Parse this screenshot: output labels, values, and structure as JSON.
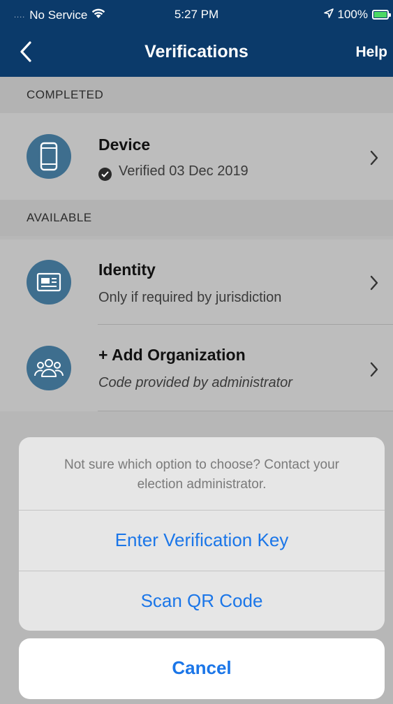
{
  "status_bar": {
    "carrier_dots": "....",
    "carrier": "No Service",
    "time": "5:27 PM",
    "battery": "100%",
    "icons": [
      "wifi-icon",
      "location-arrow-icon",
      "battery-charging-icon"
    ]
  },
  "nav": {
    "title": "Verifications",
    "help": "Help",
    "back_icon": "chevron-left-icon"
  },
  "completed": {
    "header": "COMPLETED",
    "items": [
      {
        "title": "Device",
        "subtitle": "Verified 03 Dec 2019",
        "icon": "phone-icon",
        "status_icon": "check-circle-icon"
      }
    ]
  },
  "available": {
    "header": "AVAILABLE",
    "items": [
      {
        "title": "Identity",
        "subtitle": "Only if required by jurisdiction",
        "icon": "id-card-icon"
      },
      {
        "title": "+ Add Organization",
        "subtitle": "Code provided by administrator",
        "icon": "group-icon"
      }
    ]
  },
  "action_sheet": {
    "message": "Not sure which option to choose? Contact your election administrator.",
    "options": [
      "Enter Verification Key",
      "Scan QR Code"
    ],
    "cancel": "Cancel"
  },
  "colors": {
    "nav_bar": "#0b3a6a",
    "icon_circle": "#3e6e8e",
    "action_blue": "#1b76e8"
  }
}
